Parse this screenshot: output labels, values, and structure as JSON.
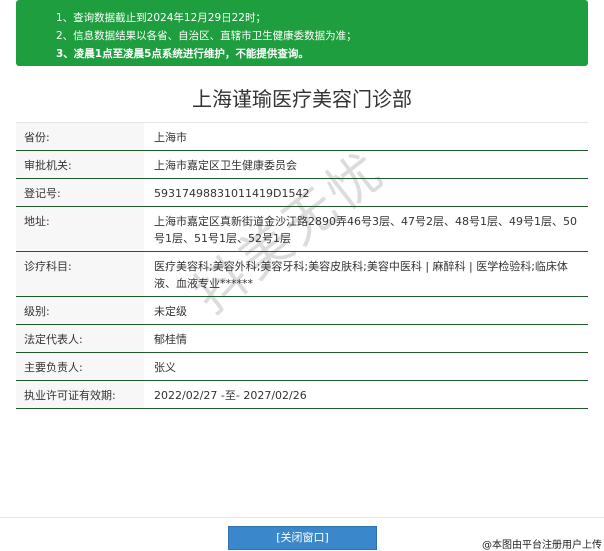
{
  "notice": {
    "lines": [
      "1、查询数据截止到2024年12月29日22时；",
      "2、信息数据结果以各省、自治区、直辖市卫生健康委数据为准；",
      "3、凌晨1点至凌晨5点系统进行维护，不能提供查询。"
    ]
  },
  "title": "上海谨瑜医疗美容门诊部",
  "rows": [
    {
      "label": "省份:",
      "value": "上海市"
    },
    {
      "label": "审批机关:",
      "value": "上海市嘉定区卫生健康委员会"
    },
    {
      "label": "登记号:",
      "value": "59317498831011419D1542"
    },
    {
      "label": "地址:",
      "value": "上海市嘉定区真新街道金沙江路2890弄46号3层、47号2层、48号1层、49号1层、50号1层、51号1层、52号1层"
    },
    {
      "label": "诊疗科目:",
      "value": "医疗美容科;美容外科;美容牙科;美容皮肤科;美容中医科 | 麻醉科 | 医学检验科;临床体液、血液专业******"
    },
    {
      "label": "级别:",
      "value": "未定级"
    },
    {
      "label": "法定代表人:",
      "value": "郁桂情"
    },
    {
      "label": "主要负责人:",
      "value": "张义"
    },
    {
      "label": "执业许可证有效期:",
      "value": "2022/02/27 -至- 2027/02/26"
    }
  ],
  "close_button": "[关闭窗口]",
  "credit": "@本图由平台注册用户上传",
  "watermark": "抖美无忧"
}
